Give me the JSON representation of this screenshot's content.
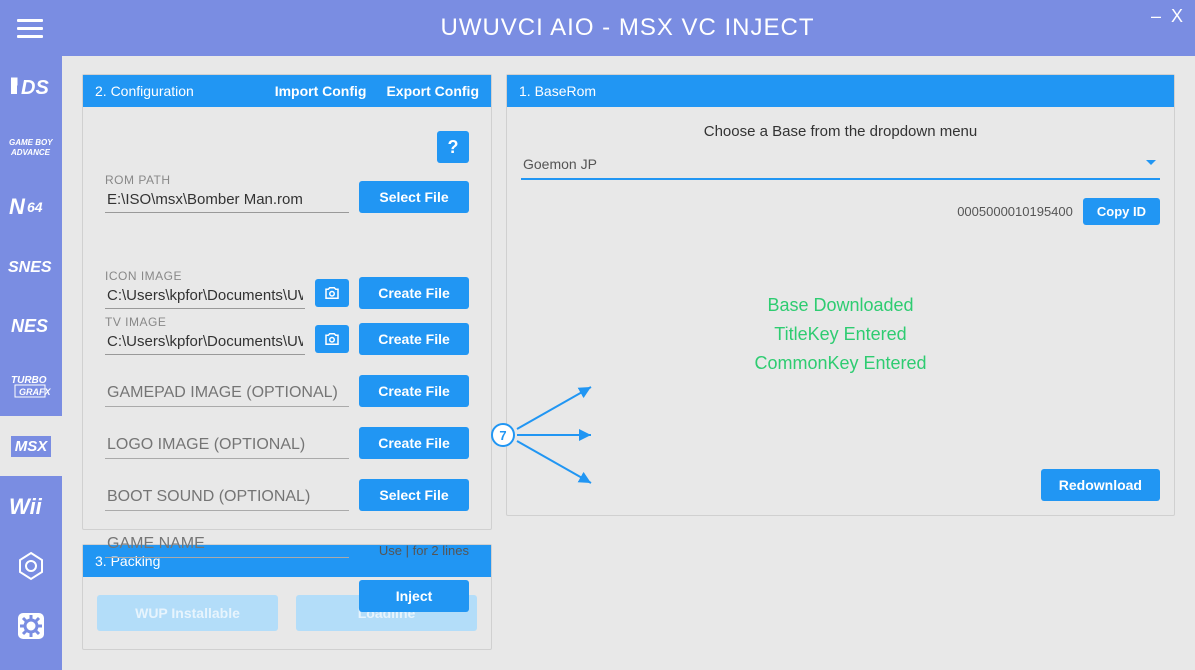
{
  "titlebar": {
    "title": "UWUVCI AIO - MSX VC INJECT"
  },
  "sidebar": {
    "items": [
      {
        "label": "DS"
      },
      {
        "label": "GBA"
      },
      {
        "label": "N64"
      },
      {
        "label": "SNES"
      },
      {
        "label": "NES"
      },
      {
        "label": "TG16"
      },
      {
        "label": "MSX"
      },
      {
        "label": "Wii"
      },
      {
        "label": "GCN"
      },
      {
        "label": "settings"
      }
    ]
  },
  "baserom": {
    "header": "1. BaseRom",
    "instruction": "Choose a Base from the dropdown menu",
    "selected": "Goemon JP",
    "title_id": "0005000010195400",
    "copy_btn": "Copy ID",
    "status1": "Base Downloaded",
    "status2": "TitleKey Entered",
    "status3": "CommonKey Entered",
    "redownload": "Redownload"
  },
  "config": {
    "header": "2. Configuration",
    "import": "Import Config",
    "export": "Export Config",
    "help": "?",
    "rom_label": "ROM PATH",
    "rom_value": "E:\\ISO\\msx\\Bomber Man.rom",
    "icon_label": "ICON IMAGE",
    "icon_value": "C:\\Users\\kpfor\\Documents\\UWUVCI AIO\\bin\\createdIM",
    "tv_label": "TV IMAGE",
    "tv_value": "C:\\Users\\kpfor\\Documents\\UWUVCI AIO\\bin\\createdIM",
    "gamepad_label": "GAMEPAD IMAGE (OPTIONAL)",
    "logo_label": "LOGO IMAGE (OPTIONAL)",
    "bootsound_label": "BOOT SOUND (OPTIONAL)",
    "gamename_label": "GAME NAME",
    "select_file": "Select File",
    "create_file": "Create File",
    "hint": "Use | for 2 lines",
    "inject": "Inject"
  },
  "packing": {
    "header": "3. Packing",
    "wup": "WUP Installable",
    "loadiine": "Loadiine"
  },
  "annotation": {
    "num": "7"
  }
}
